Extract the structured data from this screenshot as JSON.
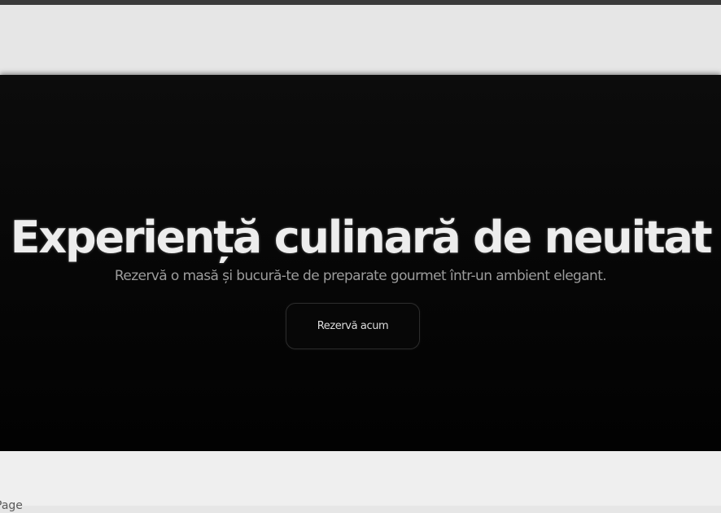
{
  "hero": {
    "title": "Experiență culinară de neuitat",
    "subtitle": "Rezervă o masă și bucură-te de preparate gourmet într-un ambient elegant.",
    "cta_label": "Rezervă acum"
  },
  "footer": {
    "page_label": "Page"
  }
}
